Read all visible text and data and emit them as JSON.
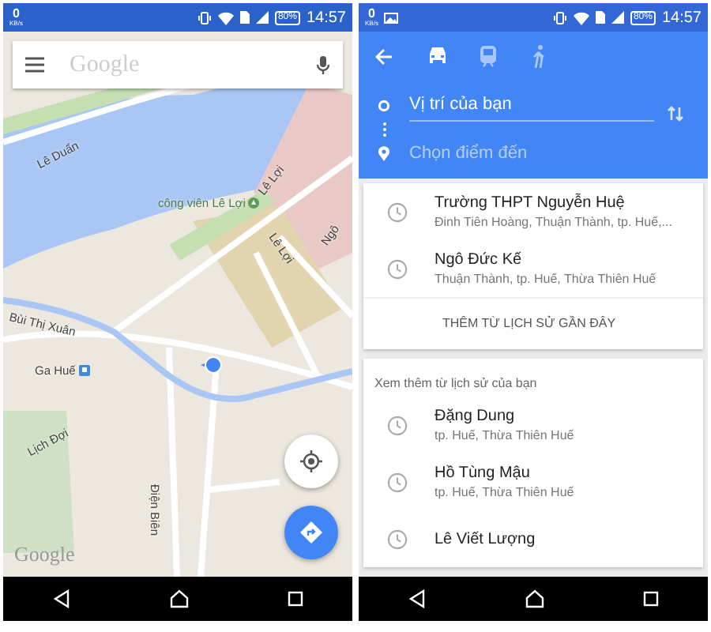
{
  "screens": [
    {
      "kind": "map",
      "status_bar": {
        "speed": "0",
        "speed_unit": "KB/s",
        "image_notification": false,
        "battery": "80%",
        "time": "14:57"
      },
      "search": {
        "placeholder": "Google"
      },
      "map_labels": [
        {
          "text": "Lê Duẩn",
          "kind": "street"
        },
        {
          "text": "công viên Lê Lợi",
          "kind": "park"
        },
        {
          "text": "Lê Lợi",
          "kind": "street"
        },
        {
          "text": "Lê Lợi",
          "kind": "street"
        },
        {
          "text": "Ngô",
          "kind": "street"
        },
        {
          "text": "Bùi Thị Xuân",
          "kind": "street"
        },
        {
          "text": "Ga Huế",
          "kind": "station"
        },
        {
          "text": "Lịch Đợi",
          "kind": "street"
        },
        {
          "text": "Điện Biên",
          "kind": "street"
        }
      ],
      "map_logo": "Google"
    },
    {
      "kind": "directions",
      "status_bar": {
        "speed": "0",
        "speed_unit": "KB/s",
        "image_notification": true,
        "battery": "80%",
        "time": "14:57"
      },
      "travel_modes": [
        {
          "kind": "car",
          "selected": true
        },
        {
          "kind": "transit",
          "selected": false
        },
        {
          "kind": "walk",
          "selected": false
        }
      ],
      "origin": {
        "value": "Vị trí của bạn"
      },
      "destination": {
        "placeholder": "Chọn điểm đến"
      },
      "recent": {
        "items": [
          {
            "title": "Trường THPT Nguyễn Huệ",
            "subtitle": "Đinh Tiên Hoàng, Thuận Thành, tp. Huế,..."
          },
          {
            "title": "Ngô Đức Kế",
            "subtitle": "Thuận Thành, tp. Huế, Thừa Thiên Huế"
          }
        ],
        "more_link": "THÊM TỪ LỊCH SỬ GẦN ĐÂY"
      },
      "history": {
        "heading": "Xem thêm từ lịch sử của bạn",
        "items": [
          {
            "title": "Đặng Dung",
            "subtitle": "tp. Huế, Thừa Thiên Huế"
          },
          {
            "title": "Hồ Tùng Mậu",
            "subtitle": "tp. Huế, Thừa Thiên Huế"
          },
          {
            "title": "Lê Viết Lượng"
          }
        ]
      }
    }
  ]
}
